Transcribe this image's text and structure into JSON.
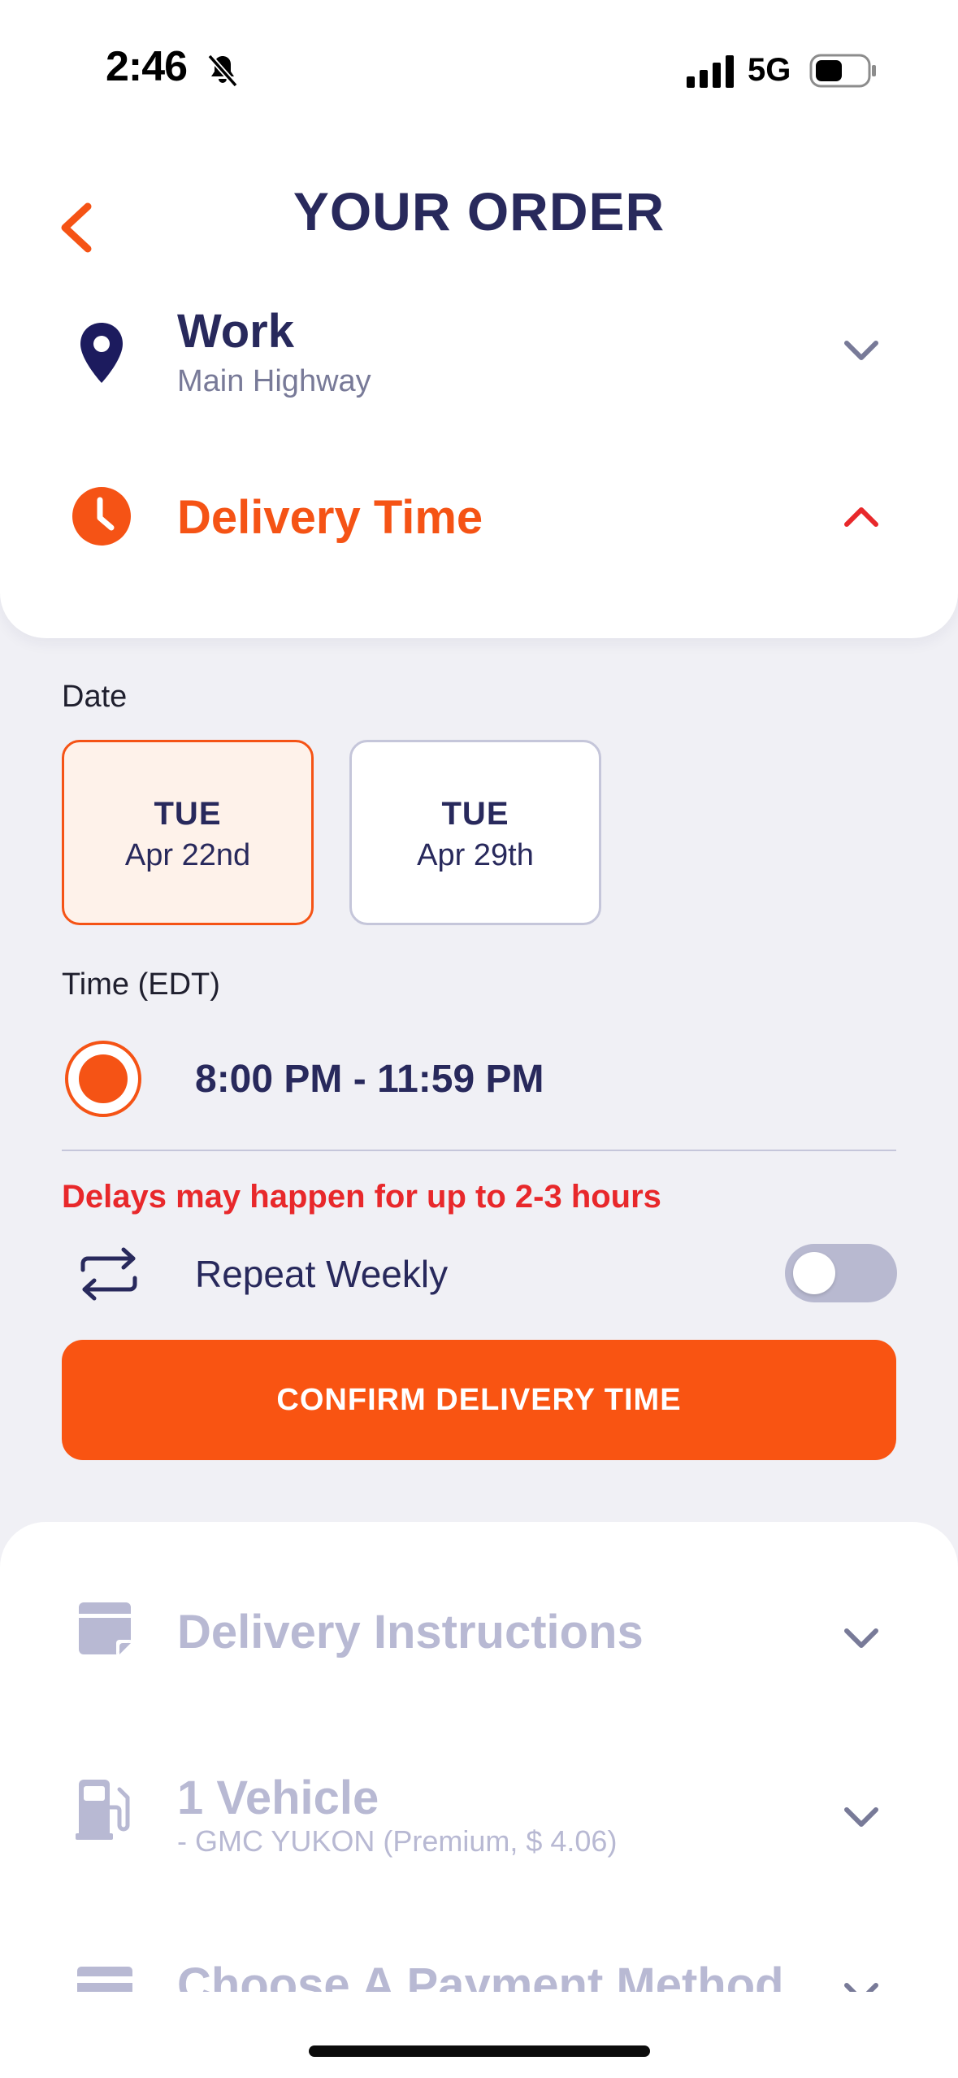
{
  "status_bar": {
    "time": "2:46",
    "network": "5G"
  },
  "header": {
    "title": "YOUR ORDER"
  },
  "location": {
    "title": "Work",
    "subtitle": "Main Highway",
    "icon": "map-pin-icon"
  },
  "delivery_time": {
    "title": "Delivery Time",
    "icon": "clock-icon"
  },
  "date_section": {
    "label": "Date",
    "options": [
      {
        "day": "TUE",
        "date": "Apr 22nd",
        "selected": true
      },
      {
        "day": "TUE",
        "date": "Apr 29th",
        "selected": false
      }
    ]
  },
  "time_section": {
    "label": "Time (EDT)",
    "slot": "8:00 PM - 11:59 PM",
    "selected": true
  },
  "delay_note": "Delays may happen for up to 2-3 hours",
  "repeat": {
    "label": "Repeat Weekly",
    "enabled": false
  },
  "confirm_button": "CONFIRM DELIVERY TIME",
  "instructions": {
    "title": "Delivery Instructions",
    "icon": "note-icon"
  },
  "vehicle": {
    "title": "1 Vehicle",
    "subtitle": "- GMC YUKON (Premium, $ 4.06)",
    "icon": "fuel-pump-icon"
  },
  "payment": {
    "title": "Choose A Payment Method",
    "icon": "credit-card-icon"
  },
  "colors": {
    "accent": "#f95412",
    "navy": "#28295c",
    "warning": "#e8282b",
    "muted": "#b8b9d3"
  }
}
